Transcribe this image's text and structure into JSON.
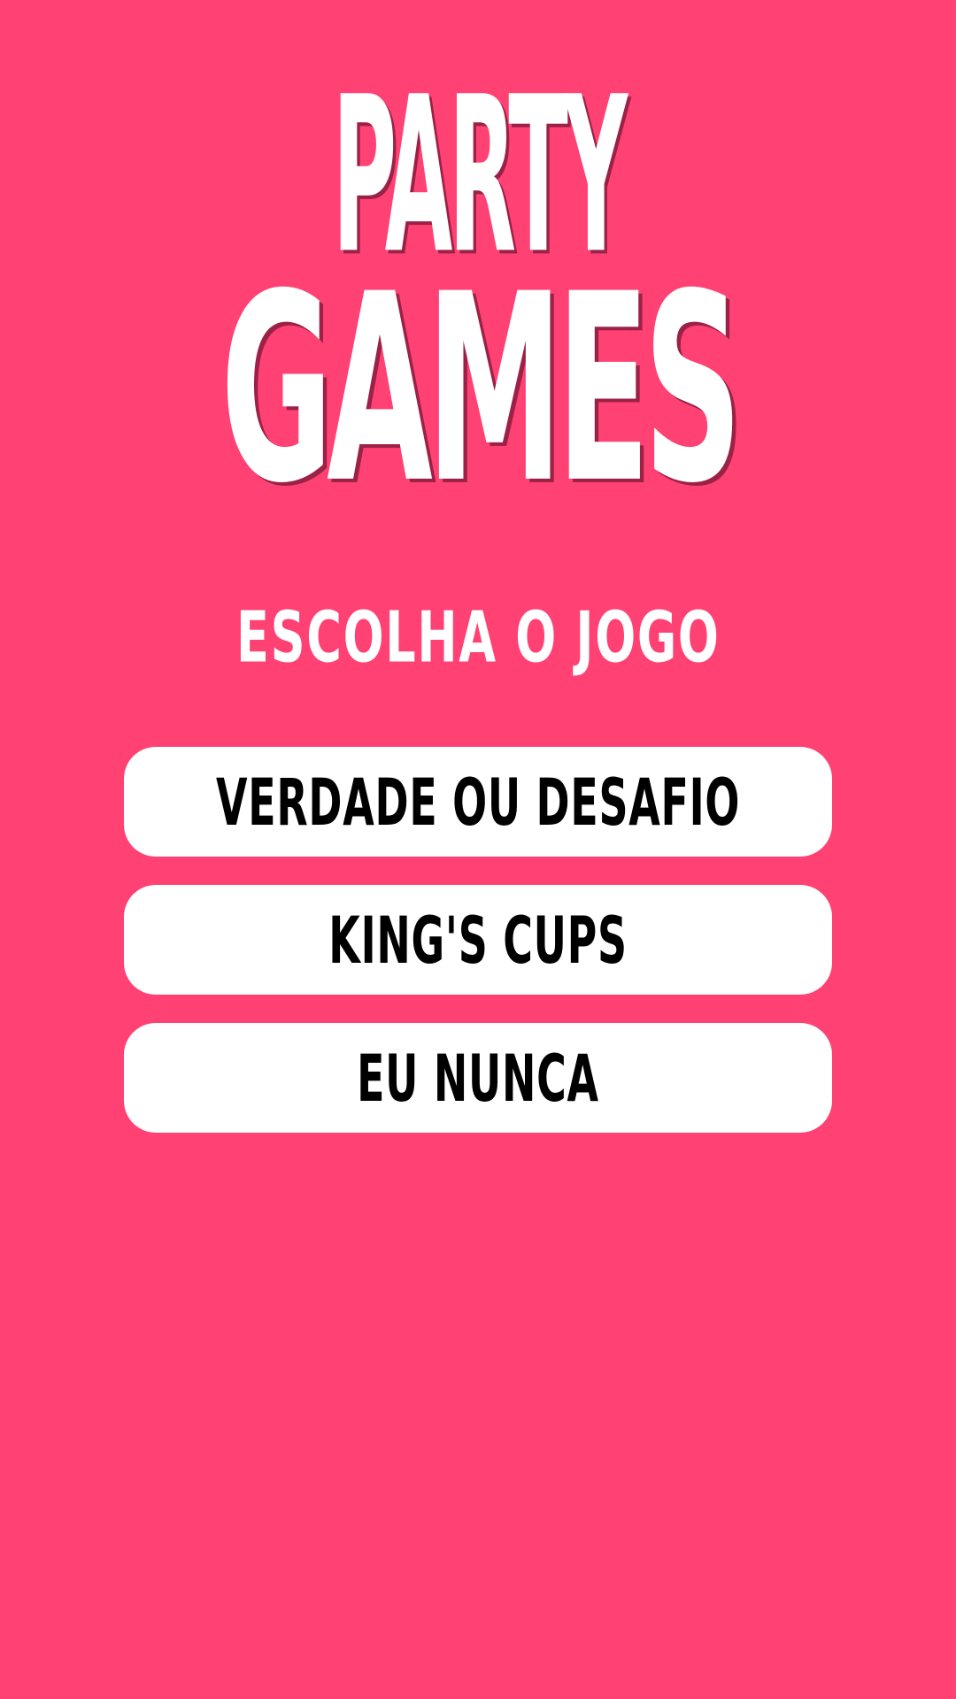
{
  "app": {
    "logo_line_1": "PARTY",
    "logo_line_2": "GAMES"
  },
  "menu": {
    "title": "ESCOLHA O JOGO",
    "games": [
      {
        "label": "VERDADE OU DESAFIO"
      },
      {
        "label": "KING'S CUPS"
      },
      {
        "label": "EU NUNCA"
      }
    ]
  },
  "colors": {
    "background": "#ff4173",
    "logo_text": "#ffffff",
    "logo_shadow": "#9b2146",
    "button_background": "#ffffff",
    "button_text": "#000000"
  }
}
